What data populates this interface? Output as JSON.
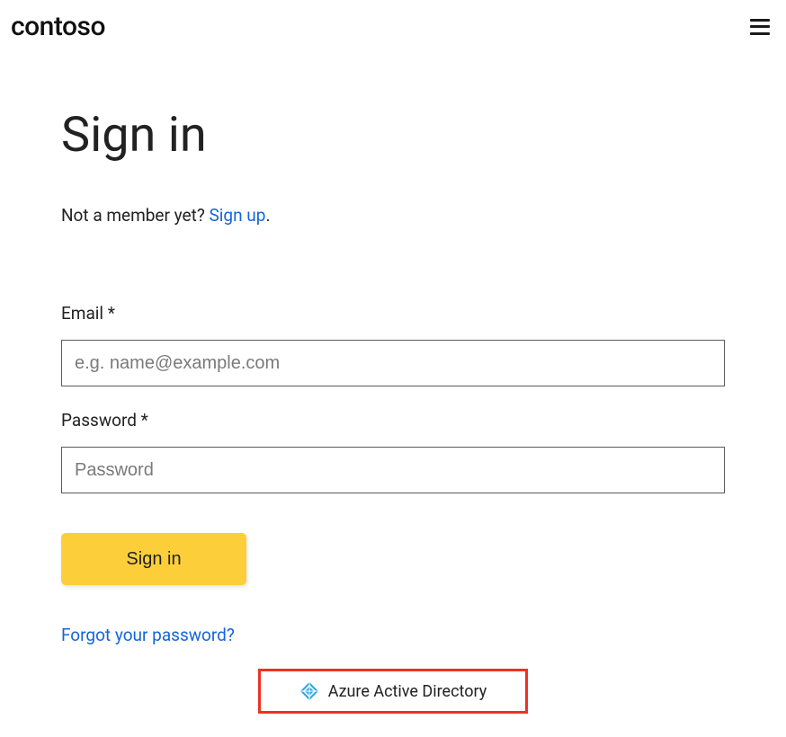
{
  "header": {
    "brand": "contoso"
  },
  "page": {
    "title": "Sign in",
    "member_prefix": "Not a member yet? ",
    "signup_link": "Sign up",
    "period": "."
  },
  "form": {
    "email": {
      "label": "Email *",
      "placeholder": "e.g. name@example.com"
    },
    "password": {
      "label": "Password *",
      "placeholder": "Password"
    },
    "submit_label": "Sign in",
    "forgot_label": "Forgot your password?"
  },
  "sso": {
    "azure_label": "Azure Active Directory"
  }
}
